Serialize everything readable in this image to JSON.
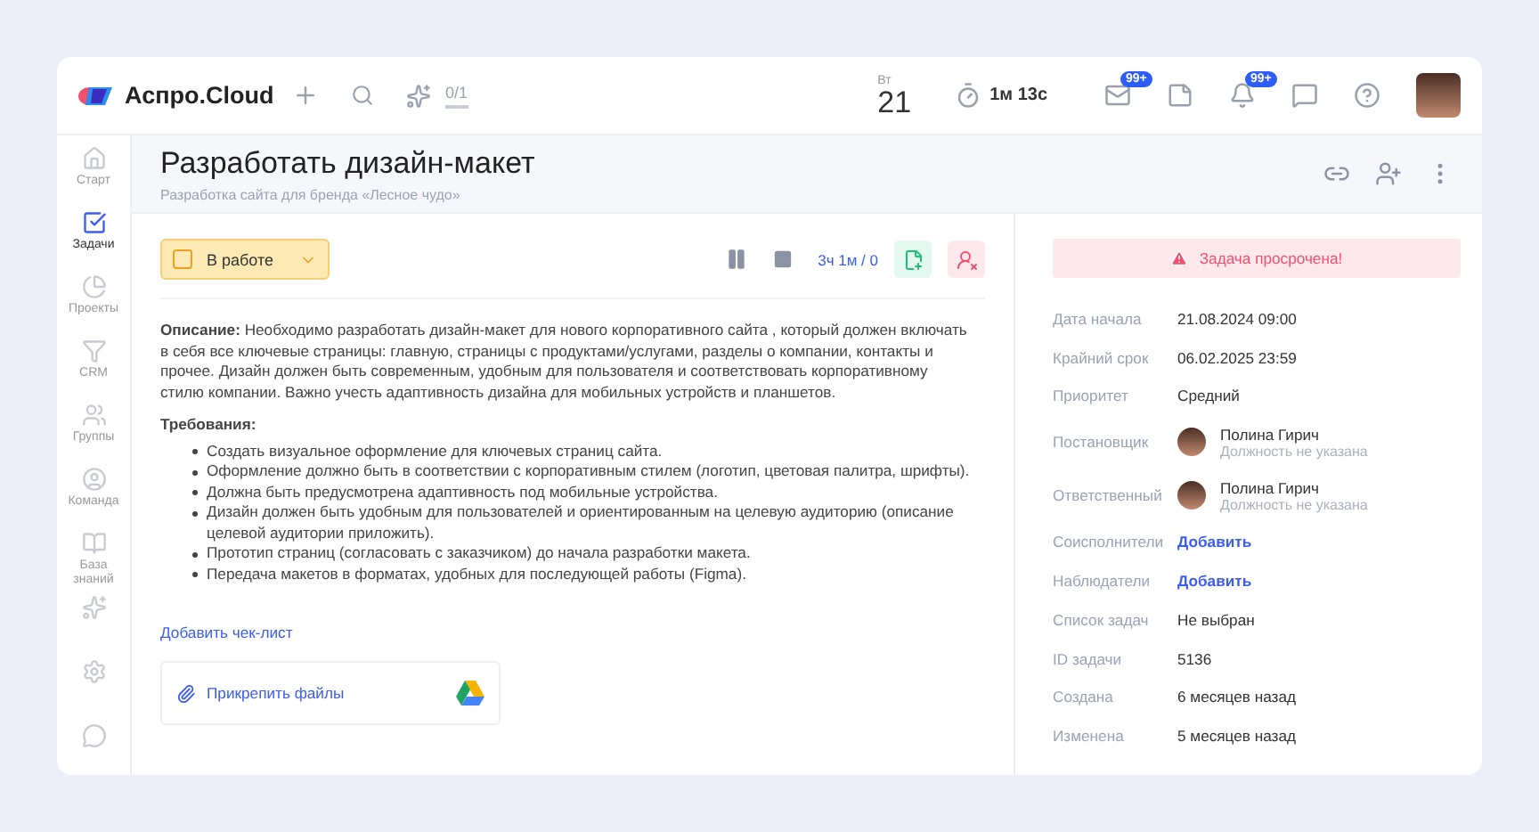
{
  "topbar": {
    "logo": "Аспро.Cloud",
    "counter": "0/1",
    "day_of_week": "Вт",
    "day": "21",
    "timer": "1м 13с",
    "badges": [
      {
        "kind": "mail",
        "count": "99+"
      },
      {
        "kind": "notes"
      },
      {
        "kind": "bell",
        "count": "99+"
      },
      {
        "kind": "chat"
      },
      {
        "kind": "help"
      }
    ]
  },
  "sidebar": {
    "items": [
      {
        "label": "Старт",
        "selected": false
      },
      {
        "label": "Задачи",
        "selected": true
      },
      {
        "label": "Проекты",
        "selected": false
      },
      {
        "label": "CRM",
        "selected": false
      },
      {
        "label": "Группы",
        "selected": false
      },
      {
        "label": "Команда",
        "selected": false
      },
      {
        "label": "База знаний",
        "selected": false
      },
      {
        "selected": false
      },
      {
        "selected": false
      },
      {
        "selected": false
      }
    ]
  },
  "header": {
    "title": "Разработать дизайн-макет",
    "subtitle": "Разработка сайта для бренда «Лесное чудо»"
  },
  "task": {
    "status": "В работе",
    "time_spent": "3ч 1м / 0",
    "description": "**Описание:** Необходимо разработать дизайн-макет для нового корпоративного сайта , который должен включать в себя все ключевые страницы: главную, страницы с продуктами/услугами, разделы о компании, контакты и прочее. Дизайн должен быть современным, удобным для пользователя и соответствовать корпоративному стилю компании. Важно учесть адаптивность дизайна для мобильных устройств и планшетов.",
    "requirements_title": "Требования:",
    "requirements": [
      "Создать визуальное оформление для ключевых страниц сайта.",
      "Оформление должно быть в соответствии с корпоративным стилем (логотип, цветовая палитра, шрифты).",
      "Должна быть предусмотрена адаптивность под мобильные устройства.",
      "Дизайн должен быть удобным для пользователей и ориентированным на целевую аудиторию (описание целевой аудитории приложить).",
      "Прототип страниц (согласовать с заказчиком) до начала разработки макета.",
      "Передача макетов в форматах, удобных для последующей работы (Figma)."
    ],
    "add_checklist": "Добавить чек-лист",
    "attach_files": "Прикрепить файлы"
  },
  "details": {
    "alert": "Задача просрочена!",
    "rows": [
      {
        "kind": "text",
        "label": "Дата начала",
        "value": "21.08.2024 09:00"
      },
      {
        "kind": "text",
        "label": "Крайний срок",
        "value": "06.02.2025 23:59"
      },
      {
        "kind": "text",
        "label": "Приоритет",
        "value": "Средний"
      },
      {
        "kind": "person",
        "label": "Постановщик",
        "value": "Полина Гирич",
        "note": "Должность не указана"
      },
      {
        "kind": "person",
        "label": "Ответственный",
        "value": "Полина Гирич",
        "note": "Должность не указана"
      },
      {
        "kind": "link",
        "label": "Соисполнители",
        "value": "Добавить"
      },
      {
        "kind": "link",
        "label": "Наблюдатели",
        "value": "Добавить"
      },
      {
        "kind": "text",
        "label": "Список задач",
        "value": "Не выбран"
      },
      {
        "kind": "text",
        "label": "ID задачи",
        "value": "5136"
      },
      {
        "kind": "text",
        "label": "Создана",
        "value": "6 месяцев назад"
      },
      {
        "kind": "text",
        "label": "Изменена",
        "value": "5 месяцев назад"
      }
    ]
  }
}
